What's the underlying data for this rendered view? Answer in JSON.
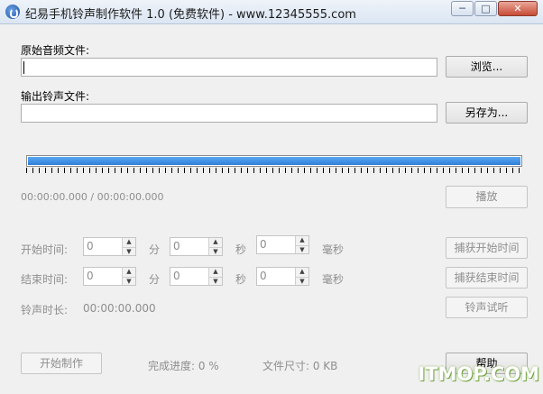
{
  "window": {
    "title": "纪易手机铃声制作软件 1.0 (免费软件) - www.12345555.com",
    "controls": {
      "minimize": "─",
      "maximize": "□",
      "close": "✕"
    }
  },
  "source": {
    "label": "原始音频文件:",
    "value": "",
    "browse_label": "浏览..."
  },
  "output": {
    "label": "输出铃声文件:",
    "value": "",
    "saveas_label": "另存为..."
  },
  "playback": {
    "progress": 1.0,
    "time_display": "00:00:00.000 / 00:00:00.000",
    "play_label": "播放"
  },
  "start_time": {
    "label": "开始时间:",
    "minutes": "0",
    "seconds": "0",
    "ms": "0",
    "unit_min": "分",
    "unit_sec": "秒",
    "unit_ms": "毫秒",
    "capture_label": "捕获开始时间"
  },
  "end_time": {
    "label": "结束时间:",
    "minutes": "0",
    "seconds": "0",
    "ms": "0",
    "unit_min": "分",
    "unit_sec": "秒",
    "unit_ms": "毫秒",
    "capture_label": "捕获结束时间"
  },
  "duration": {
    "label": "铃声时长:",
    "value": "00:00:00.000",
    "preview_label": "铃声试听"
  },
  "footer": {
    "start_label": "开始制作",
    "progress_text": "完成进度: 0 %",
    "filesize_text": "文件尺寸: 0 KB",
    "help_label": "帮助"
  },
  "watermark": "ITMOP.COM",
  "colors": {
    "accent": "#3a8ee6"
  }
}
